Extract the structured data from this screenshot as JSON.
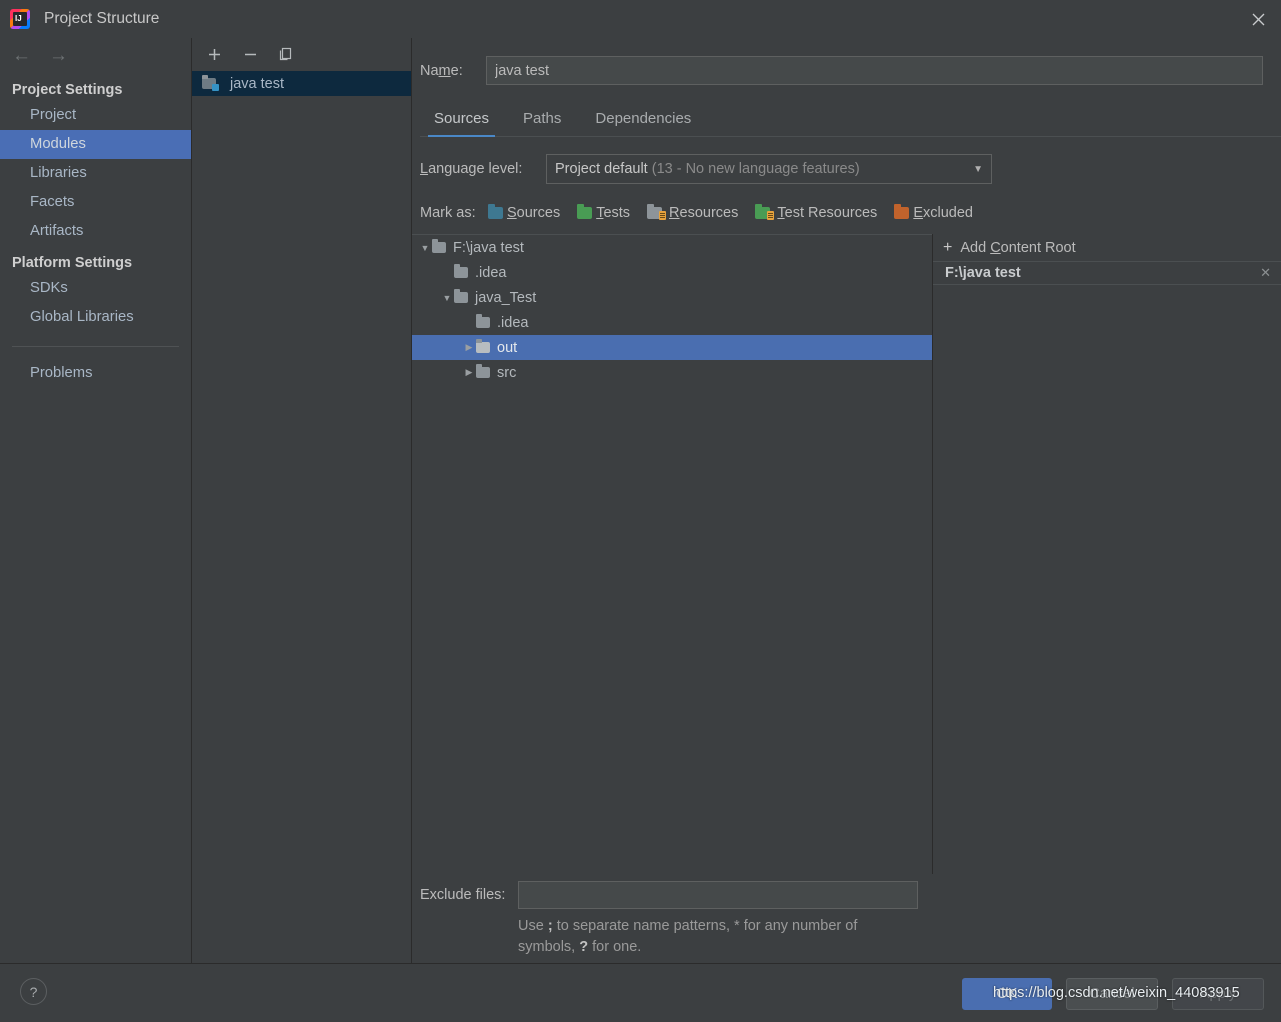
{
  "window": {
    "title": "Project Structure",
    "logo_mark": "IJ",
    "close_icon": "close-icon"
  },
  "sidebar": {
    "back_icon": "←",
    "forward_icon": "→",
    "groups": [
      {
        "label": "Project Settings",
        "items": [
          {
            "label": "Project",
            "selected": false
          },
          {
            "label": "Modules",
            "selected": true
          },
          {
            "label": "Libraries",
            "selected": false
          },
          {
            "label": "Facets",
            "selected": false
          },
          {
            "label": "Artifacts",
            "selected": false
          }
        ]
      },
      {
        "label": "Platform Settings",
        "items": [
          {
            "label": "SDKs",
            "selected": false
          },
          {
            "label": "Global Libraries",
            "selected": false
          }
        ]
      }
    ],
    "problems_label": "Problems"
  },
  "module_panel": {
    "toolbar": {
      "add_label": "+",
      "remove_label": "−",
      "copy_icon": "copy-icon"
    },
    "modules": [
      {
        "name": "java test",
        "selected": true
      }
    ]
  },
  "main": {
    "name_label": "Name:",
    "name_value": "java test",
    "name_placeholder": "",
    "tabs": [
      {
        "label": "Sources",
        "active": true
      },
      {
        "label": "Paths",
        "active": false
      },
      {
        "label": "Dependencies",
        "active": false
      }
    ],
    "language_level": {
      "label": "Language level:",
      "value_main": "Project default",
      "value_dim": "(13 - No new language features)",
      "arrow_icon": "chevron-down-icon"
    },
    "mark_as": {
      "label": "Mark as:",
      "options": [
        {
          "label": "Sources",
          "mnemonic": "S",
          "rest": "ources",
          "color": "#3e7891",
          "badge": false
        },
        {
          "label": "Tests",
          "mnemonic": "T",
          "rest": "ests",
          "color": "#499c54",
          "badge": false
        },
        {
          "label": "Resources",
          "mnemonic": "R",
          "rest": "esources",
          "color": "#8d9499",
          "badge": true
        },
        {
          "label": "Test Resources",
          "mnemonic": "T",
          "rest": "est Resources",
          "color": "#499c54",
          "badge": true
        },
        {
          "label": "Excluded",
          "mnemonic": "E",
          "rest": "xcluded",
          "color": "#c1632c",
          "badge": false
        }
      ]
    },
    "tree": [
      {
        "label": "F:\\java test",
        "indent": 0,
        "twisty": "expanded",
        "selected": false
      },
      {
        "label": ".idea",
        "indent": 1,
        "twisty": "none",
        "selected": false
      },
      {
        "label": "java_Test",
        "indent": 1,
        "twisty": "expanded",
        "selected": false
      },
      {
        "label": ".idea",
        "indent": 2,
        "twisty": "none",
        "selected": false
      },
      {
        "label": "out",
        "indent": 2,
        "twisty": "collapsed",
        "selected": true
      },
      {
        "label": "src",
        "indent": 2,
        "twisty": "collapsed",
        "selected": false
      }
    ],
    "content_roots": {
      "add_label_mnemonic": "C",
      "add_label_pre": "Add ",
      "add_label_post": "ontent Root",
      "plus_icon": "plus-icon",
      "roots": [
        {
          "path": "F:\\java test",
          "close_icon": "close-icon"
        }
      ]
    },
    "exclude": {
      "label": "Exclude files:",
      "value": "",
      "placeholder": "",
      "hint_part1": "Use ",
      "hint_sep": ";",
      "hint_part2": " to separate name patterns, * for any number of symbols, ",
      "hint_q": "?",
      "hint_part3": " for one."
    }
  },
  "footer": {
    "help_label": "?",
    "ok_label": "OK",
    "cancel_label": "Cancel",
    "apply_label": "Apply"
  },
  "watermark": "https://blog.csdn.net/weixin_44083915"
}
